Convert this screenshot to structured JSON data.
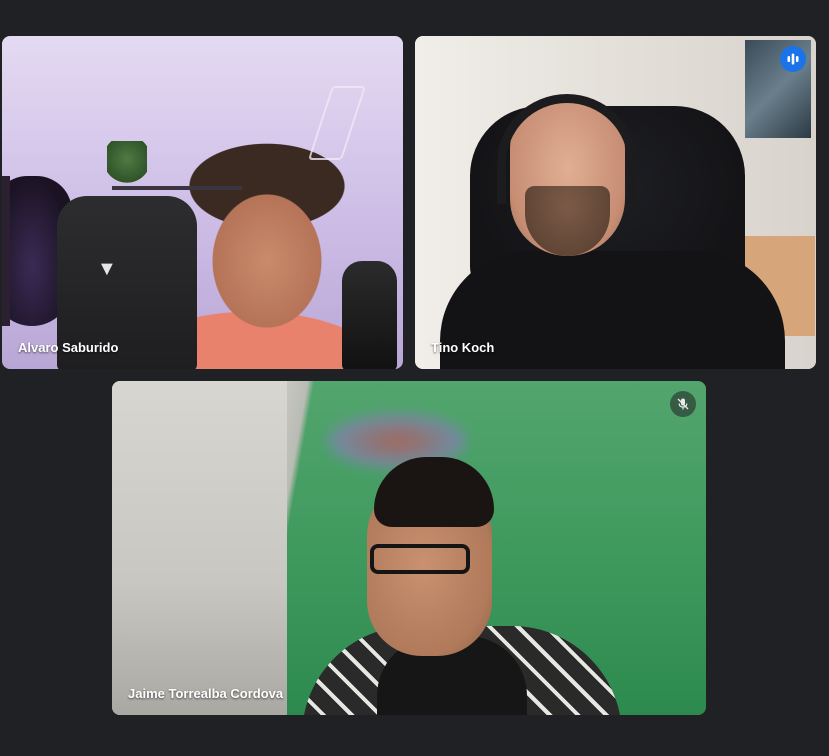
{
  "participants": [
    {
      "name": "Alvaro Saburido",
      "speaking": false,
      "muted": false
    },
    {
      "name": "Tino Koch",
      "speaking": true,
      "muted": false,
      "status_icon": "audio-level-icon"
    },
    {
      "name": "Jaime Torrealba Cordova",
      "speaking": false,
      "muted": true,
      "status_icon": "mic-off-icon"
    }
  ],
  "colors": {
    "background": "#202124",
    "speaking_outline": "#8ab4f8",
    "speaking_badge": "#1a73e8"
  }
}
